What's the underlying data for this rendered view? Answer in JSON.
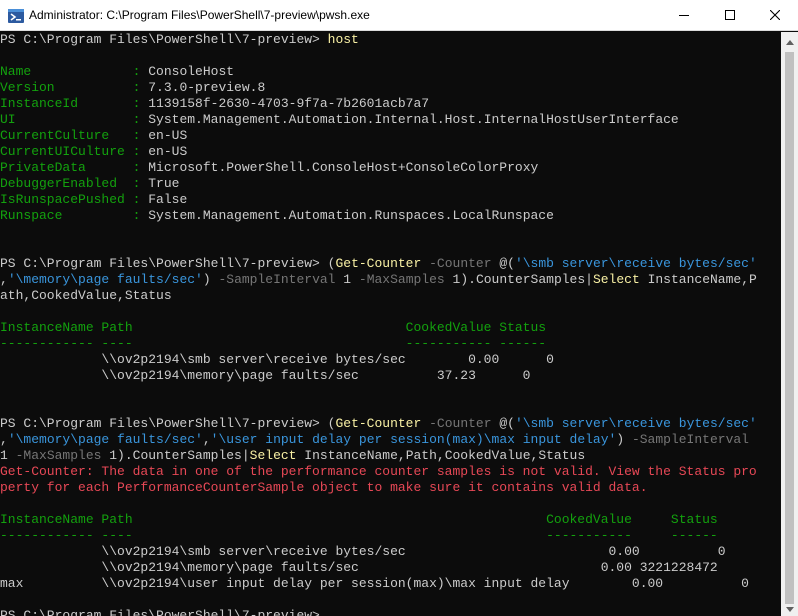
{
  "window": {
    "title": "Administrator: C:\\Program Files\\PowerShell\\7-preview\\pwsh.exe",
    "icons": {
      "app": "powershell-icon",
      "minimize": "minimize-icon",
      "maximize": "maximize-icon",
      "close": "close-icon"
    }
  },
  "colors": {
    "background": "#0c0c0c",
    "text": "#cccccc",
    "green": "#13a10e",
    "yellow": "#f9f1a5",
    "gray": "#767676",
    "cyan": "#3a96dd",
    "red": "#e74856"
  },
  "console": {
    "lines": [
      [
        {
          "c": "w",
          "t": "PS C:\\Program Files\\PowerShell\\7-preview> "
        },
        {
          "c": "y",
          "t": "host"
        }
      ],
      [],
      [
        {
          "c": "g",
          "t": "Name             : "
        },
        {
          "c": "w",
          "t": "ConsoleHost"
        }
      ],
      [
        {
          "c": "g",
          "t": "Version          : "
        },
        {
          "c": "w",
          "t": "7.3.0-preview.8"
        }
      ],
      [
        {
          "c": "g",
          "t": "InstanceId       : "
        },
        {
          "c": "w",
          "t": "1139158f-2630-4703-9f7a-7b2601acb7a7"
        }
      ],
      [
        {
          "c": "g",
          "t": "UI               : "
        },
        {
          "c": "w",
          "t": "System.Management.Automation.Internal.Host.InternalHostUserInterface"
        }
      ],
      [
        {
          "c": "g",
          "t": "CurrentCulture   : "
        },
        {
          "c": "w",
          "t": "en-US"
        }
      ],
      [
        {
          "c": "g",
          "t": "CurrentUICulture : "
        },
        {
          "c": "w",
          "t": "en-US"
        }
      ],
      [
        {
          "c": "g",
          "t": "PrivateData      : "
        },
        {
          "c": "w",
          "t": "Microsoft.PowerShell.ConsoleHost+ConsoleColorProxy"
        }
      ],
      [
        {
          "c": "g",
          "t": "DebuggerEnabled  : "
        },
        {
          "c": "w",
          "t": "True"
        }
      ],
      [
        {
          "c": "g",
          "t": "IsRunspacePushed : "
        },
        {
          "c": "w",
          "t": "False"
        }
      ],
      [
        {
          "c": "g",
          "t": "Runspace         : "
        },
        {
          "c": "w",
          "t": "System.Management.Automation.Runspaces.LocalRunspace"
        }
      ],
      [],
      [],
      [
        {
          "c": "w",
          "t": "PS C:\\Program Files\\PowerShell\\7-preview> ("
        },
        {
          "c": "y",
          "t": "Get-Counter"
        },
        {
          "c": "w",
          "t": " "
        },
        {
          "c": "d",
          "t": "-Counter"
        },
        {
          "c": "w",
          "t": " @("
        },
        {
          "c": "c",
          "t": "'\\smb server\\receive bytes/sec'"
        }
      ],
      [
        {
          "c": "w",
          "t": ","
        },
        {
          "c": "c",
          "t": "'\\memory\\page faults/sec'"
        },
        {
          "c": "w",
          "t": ") "
        },
        {
          "c": "d",
          "t": "-SampleInterval"
        },
        {
          "c": "w",
          "t": " 1 "
        },
        {
          "c": "d",
          "t": "-MaxSamples"
        },
        {
          "c": "w",
          "t": " 1).CounterSamples|"
        },
        {
          "c": "y",
          "t": "Select"
        },
        {
          "c": "w",
          "t": " InstanceName,P"
        }
      ],
      [
        {
          "c": "w",
          "t": "ath,CookedValue,Status"
        }
      ],
      [],
      [
        {
          "c": "g",
          "t": "InstanceName Path                                   CookedValue Status"
        }
      ],
      [
        {
          "c": "g",
          "t": "------------ ----                                   ----------- ------"
        }
      ],
      [
        {
          "c": "w",
          "t": "             \\\\ov2p2194\\smb server\\receive bytes/sec        0.00      0"
        }
      ],
      [
        {
          "c": "w",
          "t": "             \\\\ov2p2194\\memory\\page faults/sec          37.23      0"
        }
      ],
      [],
      [],
      [
        {
          "c": "w",
          "t": "PS C:\\Program Files\\PowerShell\\7-preview> ("
        },
        {
          "c": "y",
          "t": "Get-Counter"
        },
        {
          "c": "w",
          "t": " "
        },
        {
          "c": "d",
          "t": "-Counter"
        },
        {
          "c": "w",
          "t": " @("
        },
        {
          "c": "c",
          "t": "'\\smb server\\receive bytes/sec'"
        }
      ],
      [
        {
          "c": "w",
          "t": ","
        },
        {
          "c": "c",
          "t": "'\\memory\\page faults/sec'"
        },
        {
          "c": "w",
          "t": ","
        },
        {
          "c": "c",
          "t": "'\\user input delay per session(max)\\max input delay'"
        },
        {
          "c": "w",
          "t": ") "
        },
        {
          "c": "d",
          "t": "-SampleInterval"
        }
      ],
      [
        {
          "c": "w",
          "t": "1 "
        },
        {
          "c": "d",
          "t": "-MaxSamples"
        },
        {
          "c": "w",
          "t": " 1).CounterSamples|"
        },
        {
          "c": "y",
          "t": "Select"
        },
        {
          "c": "w",
          "t": " InstanceName,Path,CookedValue,Status"
        }
      ],
      [
        {
          "c": "r",
          "t": "Get-Counter: The data in one of the performance counter samples is not valid. View the Status pro"
        }
      ],
      [
        {
          "c": "r",
          "t": "perty for each PerformanceCounterSample object to make sure it contains valid data."
        }
      ],
      [],
      [
        {
          "c": "g",
          "t": "InstanceName Path                                                     CookedValue     Status"
        }
      ],
      [
        {
          "c": "g",
          "t": "------------ ----                                                     -----------     ------"
        }
      ],
      [
        {
          "c": "w",
          "t": "             \\\\ov2p2194\\smb server\\receive bytes/sec                          0.00          0"
        }
      ],
      [
        {
          "c": "w",
          "t": "             \\\\ov2p2194\\memory\\page faults/sec                               0.00 3221228472"
        }
      ],
      [
        {
          "c": "w",
          "t": "max          \\\\ov2p2194\\user input delay per session(max)\\max input delay        0.00          0"
        }
      ],
      [],
      [
        {
          "c": "w",
          "t": "PS C:\\Program Files\\PowerShell\\7-preview> "
        }
      ]
    ]
  },
  "scrollbar": {
    "up_icon": "scroll-up-arrow-icon",
    "down_icon": "scroll-down-arrow-icon"
  }
}
